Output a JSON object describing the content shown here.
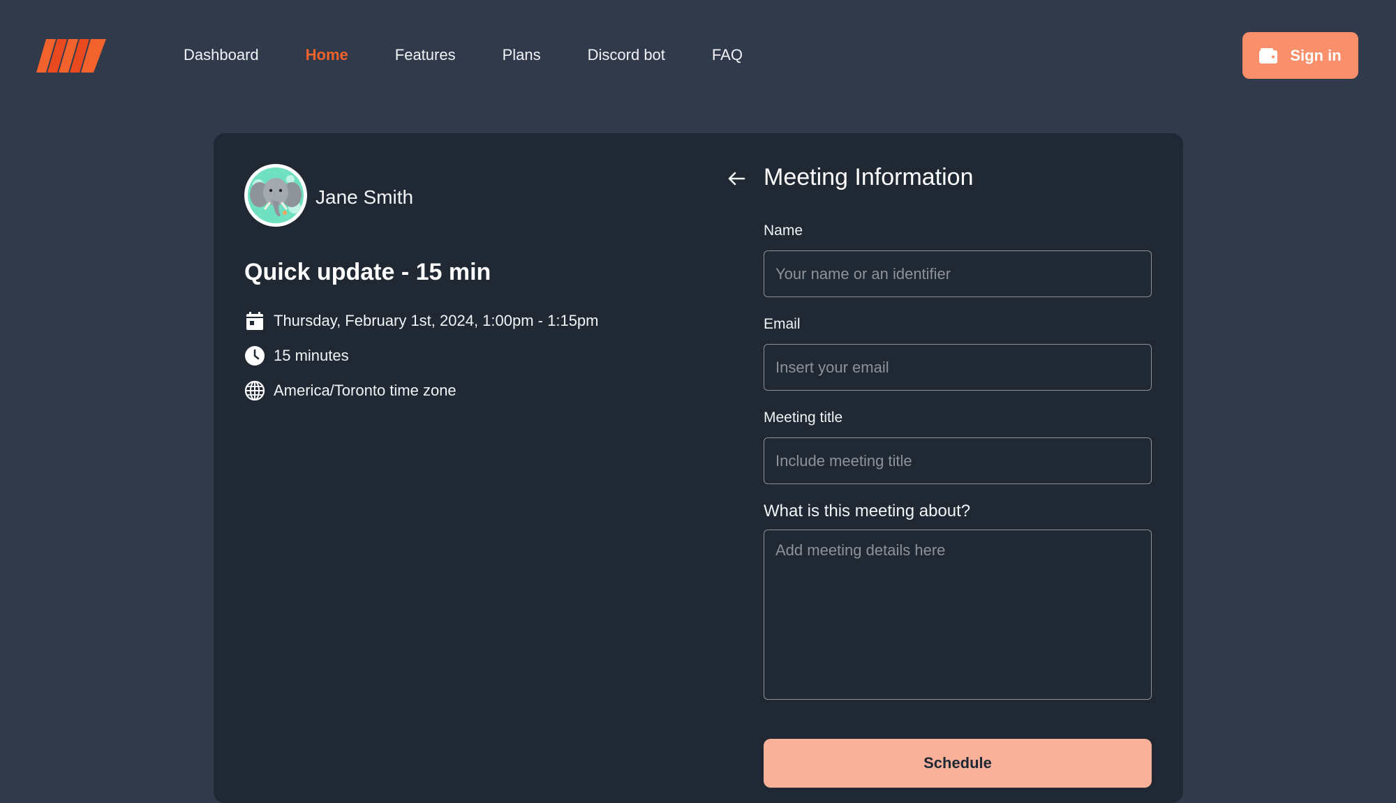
{
  "header": {
    "logo_icon": "brand-logo-icon",
    "nav": [
      {
        "label": "Dashboard",
        "active": false
      },
      {
        "label": "Home",
        "active": true
      },
      {
        "label": "Features",
        "active": false
      },
      {
        "label": "Plans",
        "active": false
      },
      {
        "label": "Discord bot",
        "active": false
      },
      {
        "label": "FAQ",
        "active": false
      }
    ],
    "signin_label": "Sign in",
    "signin_icon": "wallet-icon"
  },
  "colors": {
    "background": "#303a4b",
    "card": "#1f2833",
    "accent": "#f1622d",
    "signin_button": "#f98f6b",
    "schedule_button": "#f9b19a"
  },
  "host": {
    "name": "Jane Smith",
    "avatar_icon": "elephant-avatar"
  },
  "event": {
    "title": "Quick update - 15 min",
    "date_time": "Thursday, February 1st, 2024, 1:00pm - 1:15pm",
    "duration": "15 minutes",
    "timezone": "America/Toronto time zone"
  },
  "form": {
    "title": "Meeting Information",
    "back_icon": "arrow-left-icon",
    "name_label": "Name",
    "name_placeholder": "Your name or an identifier",
    "name_value": "",
    "email_label": "Email",
    "email_placeholder": "Insert your email",
    "email_value": "",
    "meeting_title_label": "Meeting title",
    "meeting_title_placeholder": "Include meeting title",
    "meeting_title_value": "",
    "about_label": "What is this meeting about?",
    "about_placeholder": "Add meeting details here",
    "about_value": "",
    "schedule_label": "Schedule"
  }
}
